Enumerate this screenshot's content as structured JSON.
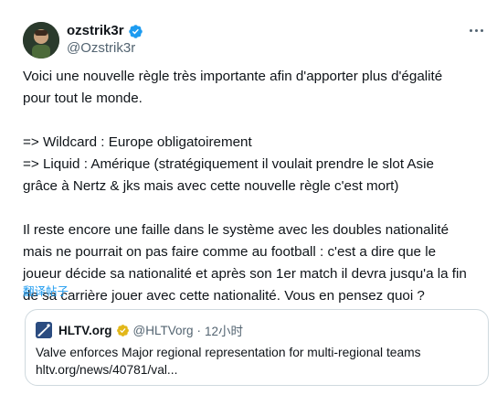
{
  "author": {
    "display_name": "ozstrik3r",
    "handle": "@Ozstrik3r",
    "verified": true
  },
  "tweet": {
    "lines": [
      "Voici une nouvelle règle très importante afin d'apporter plus d'égalité",
      "pour tout le monde.",
      "",
      "=> Wildcard : Europe obligatoirement",
      "=> Liquid : Amérique (stratégiquement il voulait prendre le slot Asie",
      "grâce à Nertz & jks mais avec cette nouvelle règle c'est mort)",
      "",
      "Il reste encore une faille dans le système avec les doubles nationalité",
      "mais ne pourrait on pas faire comme au football : c'est a dire que le",
      "joueur décide sa nationalité et après son 1er match il devra jusqu'a la fin",
      "de sa carrière jouer avec cette nationalité. Vous en pensez quoi ?"
    ],
    "translate_label": "翻译帖子"
  },
  "quote": {
    "name": "HLTV.org",
    "handle": "@HLTVorg",
    "separator": "·",
    "time": "12小时",
    "verified": true,
    "text": "Valve enforces Major regional representation for multi-regional teams",
    "link": "hltv.org/news/40781/val..."
  },
  "colors": {
    "accent": "#1d9bf0",
    "verified_gold": "#e2b719",
    "text_primary": "#0f1419",
    "text_secondary": "#536471",
    "border": "#cfd9de"
  }
}
